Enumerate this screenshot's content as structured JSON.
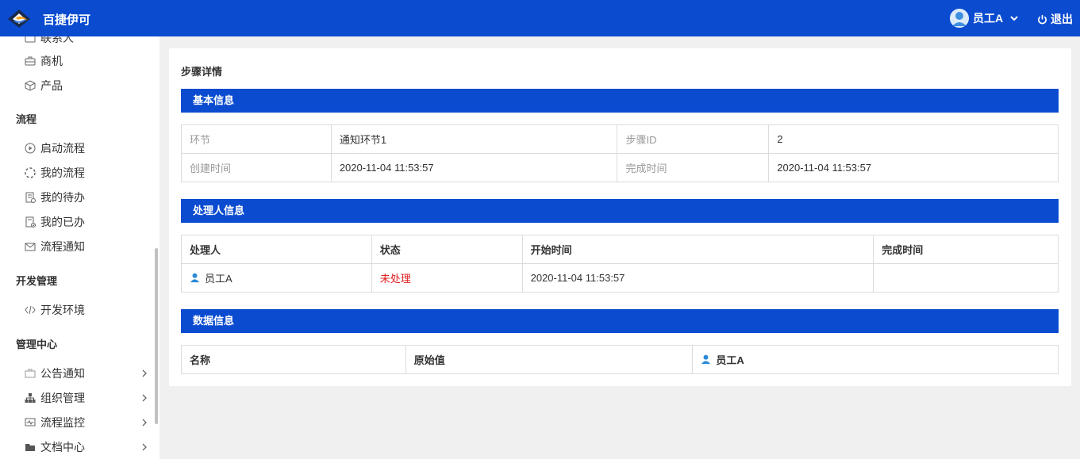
{
  "header": {
    "brand": "百捷伊可",
    "user_name": "员工A",
    "logout_label": "退出",
    "accent_color": "#0a4bd0"
  },
  "sidebar": {
    "items_top": [
      {
        "label": "联系人",
        "icon": "contacts-icon"
      },
      {
        "label": "商机",
        "icon": "briefcase-icon"
      },
      {
        "label": "产品",
        "icon": "cube-icon"
      }
    ],
    "group_flow": "流程",
    "flow_items": [
      {
        "label": "启动流程",
        "icon": "play-circle-icon"
      },
      {
        "label": "我的流程",
        "icon": "loading-circle-icon"
      },
      {
        "label": "我的待办",
        "icon": "todo-doc-icon"
      },
      {
        "label": "我的已办",
        "icon": "done-doc-icon"
      },
      {
        "label": "流程通知",
        "icon": "mail-icon"
      }
    ],
    "group_dev": "开发管理",
    "dev_items": [
      {
        "label": "开发环境",
        "icon": "code-icon"
      }
    ],
    "group_admin": "管理中心",
    "admin_items": [
      {
        "label": "公告通知",
        "icon": "announcement-icon"
      },
      {
        "label": "组织管理",
        "icon": "org-chart-icon"
      },
      {
        "label": "流程监控",
        "icon": "monitor-icon"
      },
      {
        "label": "文档中心",
        "icon": "folder-icon"
      }
    ]
  },
  "page": {
    "title": "步骤详情",
    "basic": {
      "section_title": "基本信息",
      "rows": [
        {
          "k1": "环节",
          "v1": "通知环节1",
          "k2": "步骤ID",
          "v2": "2"
        },
        {
          "k1": "创建时间",
          "v1": "2020-11-04 11:53:57",
          "k2": "完成时间",
          "v2": "2020-11-04 11:53:57"
        }
      ]
    },
    "handler": {
      "section_title": "处理人信息",
      "headers": [
        "处理人",
        "状态",
        "开始时间",
        "完成时间"
      ],
      "rows": [
        {
          "handler": "员工A",
          "status": "未处理",
          "start": "2020-11-04 11:53:57",
          "finish": ""
        }
      ]
    },
    "data": {
      "section_title": "数据信息",
      "headers": [
        "名称",
        "原始值",
        "员工A"
      ]
    }
  }
}
